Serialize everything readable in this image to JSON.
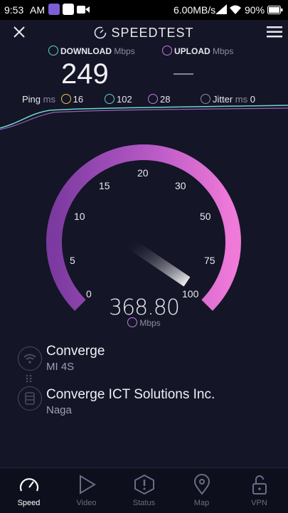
{
  "status": {
    "time": "9:53",
    "ampm": "AM",
    "net_speed": "6.00MB/s",
    "battery": "90%"
  },
  "header": {
    "title": "SPEEDTEST"
  },
  "metrics": {
    "download_label": "DOWNLOAD",
    "download_unit": "Mbps",
    "download_value": "249",
    "upload_label": "UPLOAD",
    "upload_unit": "Mbps",
    "upload_value": "—"
  },
  "ping": {
    "label": "Ping",
    "unit": "ms",
    "idle": "16",
    "down": "102",
    "up": "28",
    "jitter_label": "Jitter",
    "jitter_unit": "ms",
    "jitter": "0"
  },
  "gauge": {
    "ticks": [
      "0",
      "5",
      "10",
      "15",
      "20",
      "30",
      "50",
      "75",
      "100"
    ],
    "value": "368.80",
    "unit": "Mbps",
    "colors": {
      "start": "#8e44ad",
      "end": "#e676d6",
      "track": "#23243a"
    }
  },
  "connection": {
    "isp_name": "Converge",
    "isp_sub": "MI 4S",
    "server_name": "Converge ICT Solutions Inc.",
    "server_sub": "Naga"
  },
  "nav": [
    {
      "label": "Speed",
      "icon": "speedometer-icon"
    },
    {
      "label": "Video",
      "icon": "play-icon"
    },
    {
      "label": "Status",
      "icon": "alert-icon"
    },
    {
      "label": "Map",
      "icon": "map-pin-icon"
    },
    {
      "label": "VPN",
      "icon": "unlock-icon"
    }
  ]
}
